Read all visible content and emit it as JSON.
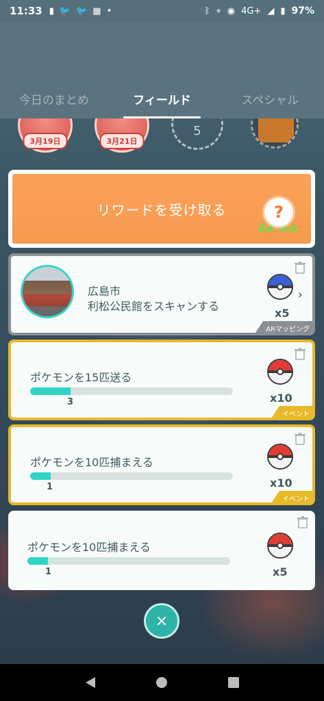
{
  "status_bar": {
    "time": "11:33",
    "network": "4G+",
    "battery": "97%"
  },
  "tabs": [
    {
      "label": "今日のまとめ",
      "active": false
    },
    {
      "label": "フィールド",
      "active": true
    },
    {
      "label": "スペシャル",
      "active": false
    }
  ],
  "badges": [
    {
      "date": "3月19日"
    },
    {
      "date": "3月21日"
    },
    {
      "count": "5"
    }
  ],
  "reward_button": {
    "label": "リワードを受け取る",
    "icon": "?"
  },
  "tasks": [
    {
      "title_line1": "広島市",
      "title_line2": "利松公民館をスキャンする",
      "reward_qty": "x5",
      "reward_item": "great-ball",
      "tag": "ARマッピング"
    },
    {
      "title": "ポケモンを15匹送る",
      "progress_count": "3",
      "progress_fraction": 0.2,
      "reward_qty": "x10",
      "reward_item": "poke-ball",
      "tag": "イベント"
    },
    {
      "title": "ポケモンを10匹捕まえる",
      "progress_count": "1",
      "progress_fraction": 0.1,
      "reward_qty": "x10",
      "reward_item": "poke-ball",
      "tag": "イベント"
    },
    {
      "title": "ポケモンを10匹捕まえる",
      "progress_count": "1",
      "progress_fraction": 0.1,
      "reward_qty": "x5",
      "reward_item": "poke-ball"
    }
  ],
  "close_icon": "×",
  "colors": {
    "accent": "#2fd4c7",
    "event_border": "#e8b928",
    "reward_orange": "#f69a4f",
    "header": "#5b737e"
  }
}
